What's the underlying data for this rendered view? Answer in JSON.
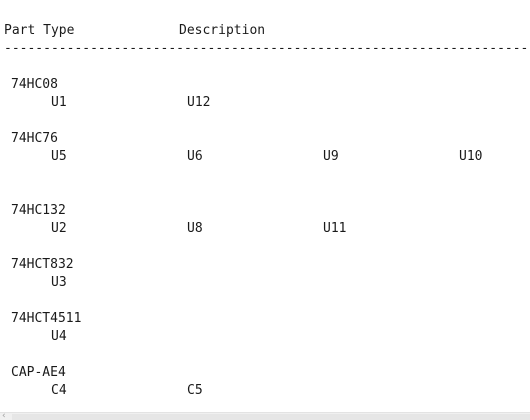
{
  "header": {
    "part_type": "Part Type",
    "description": "Description"
  },
  "divider": "------------------------------------------------------------------------------",
  "groups": [
    {
      "part": "74HC08",
      "refs": [
        "U1",
        "U12"
      ]
    },
    {
      "part": "74HC76",
      "refs": [
        "U5",
        "U6",
        "U9",
        "U10"
      ]
    },
    {
      "part": "74HC132",
      "refs": [
        "U2",
        "U8",
        "U11"
      ]
    },
    {
      "part": "74HCT832",
      "refs": [
        "U3"
      ]
    },
    {
      "part": "74HCT4511",
      "refs": [
        "U4"
      ]
    },
    {
      "part": "CAP-AE4",
      "refs": [
        "C4",
        "C5"
      ]
    }
  ],
  "icons": {
    "scroll_left": "chevron-left-icon"
  }
}
